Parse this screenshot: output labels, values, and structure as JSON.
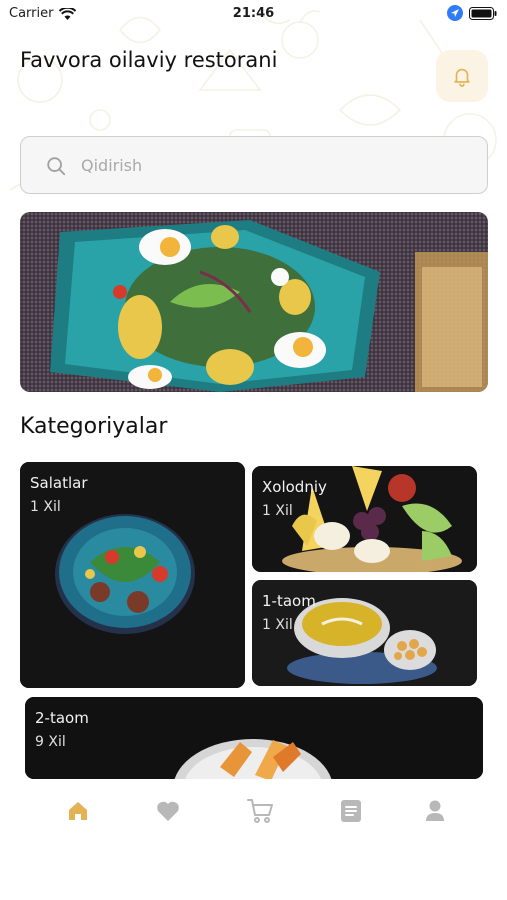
{
  "status_bar": {
    "carrier": "Carrier",
    "time": "21:46",
    "wifi_icon": "wifi-icon",
    "location_icon": "location-arrow-icon",
    "battery_icon": "battery-icon"
  },
  "header": {
    "title": "Favvora oilaviy restorani",
    "notification_icon": "bell-icon"
  },
  "search": {
    "placeholder": "Qidirish",
    "value": "",
    "icon": "search-icon"
  },
  "banner": {
    "description_icon": "food-banner-image"
  },
  "categories": {
    "title": "Kategoriyalar",
    "items": [
      {
        "name": "Salatlar",
        "count": "1 Xil"
      },
      {
        "name": "Xolodniy",
        "count": "1 Xil"
      },
      {
        "name": "1-taom",
        "count": "1 Xil"
      },
      {
        "name": "2-taom",
        "count": "9 Xil"
      }
    ]
  },
  "tabbar": {
    "tabs": [
      {
        "icon": "home-icon",
        "active": true
      },
      {
        "icon": "heart-icon",
        "active": false
      },
      {
        "icon": "cart-icon",
        "active": false
      },
      {
        "icon": "orders-icon",
        "active": false
      },
      {
        "icon": "profile-icon",
        "active": false
      }
    ]
  },
  "colors": {
    "accent": "#e2b255",
    "inactive_icon": "#b8b8b8",
    "card_bg": "#141414"
  }
}
